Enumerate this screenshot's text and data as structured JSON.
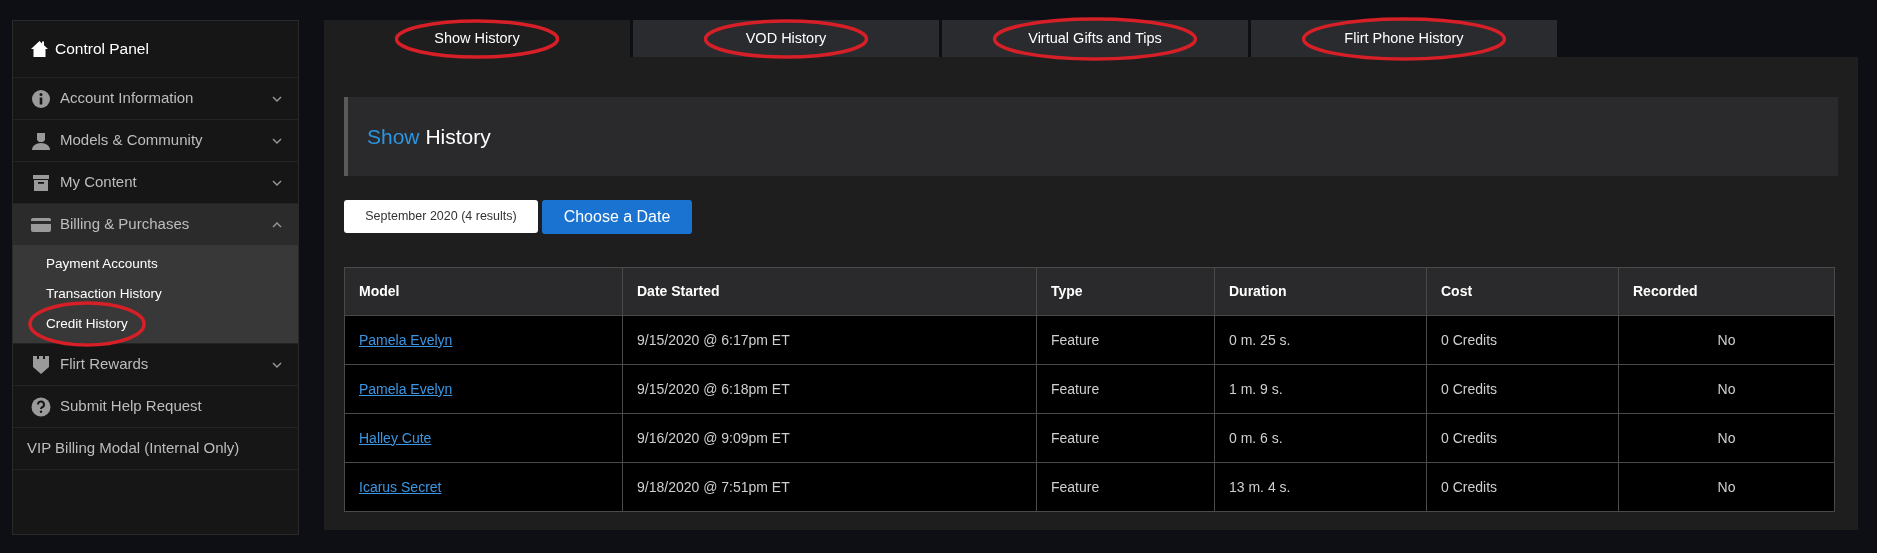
{
  "sidebar": {
    "title": "Control Panel",
    "items": [
      {
        "label": "Account Information",
        "kind": "menu",
        "expanded": false
      },
      {
        "label": "Models & Community",
        "kind": "menu",
        "expanded": false
      },
      {
        "label": "My Content",
        "kind": "menu",
        "expanded": false
      },
      {
        "label": "Billing & Purchases",
        "kind": "menu",
        "expanded": true,
        "children": [
          {
            "label": "Payment Accounts",
            "circled": false
          },
          {
            "label": "Transaction History",
            "circled": false
          },
          {
            "label": "Credit History",
            "circled": true
          }
        ]
      },
      {
        "label": "Flirt Rewards",
        "kind": "menu",
        "expanded": false
      },
      {
        "label": "Submit Help Request",
        "kind": "link"
      },
      {
        "label": "VIP Billing Modal (Internal Only)",
        "kind": "plain"
      }
    ]
  },
  "tabs": [
    {
      "label": "Show History",
      "selected": true,
      "circled": true
    },
    {
      "label": "VOD History",
      "selected": false,
      "circled": true
    },
    {
      "label": "Virtual Gifts and Tips",
      "selected": false,
      "circled": true
    },
    {
      "label": "Flirt Phone History",
      "selected": false,
      "circled": true
    }
  ],
  "heading": {
    "highlight": "Show",
    "rest": "History"
  },
  "date_filter": {
    "value": "September 2020 (4 results)",
    "button": "Choose a Date"
  },
  "table": {
    "columns": [
      "Model",
      "Date Started",
      "Type",
      "Duration",
      "Cost",
      "Recorded"
    ],
    "rows": [
      [
        "Pamela Evelyn",
        "9/15/2020 @ 6:17pm ET",
        "Feature",
        "0 m. 25 s.",
        "0 Credits",
        "No"
      ],
      [
        "Pamela Evelyn",
        "9/15/2020 @ 6:18pm ET",
        "Feature",
        "1 m. 9 s.",
        "0 Credits",
        "No"
      ],
      [
        "Halley Cute",
        "9/16/2020 @ 9:09pm ET",
        "Feature",
        "0 m. 6 s.",
        "0 Credits",
        "No"
      ],
      [
        "Icarus Secret",
        "9/18/2020 @ 7:51pm ET",
        "Feature",
        "13 m. 4 s.",
        "0 Credits",
        "No"
      ]
    ]
  }
}
